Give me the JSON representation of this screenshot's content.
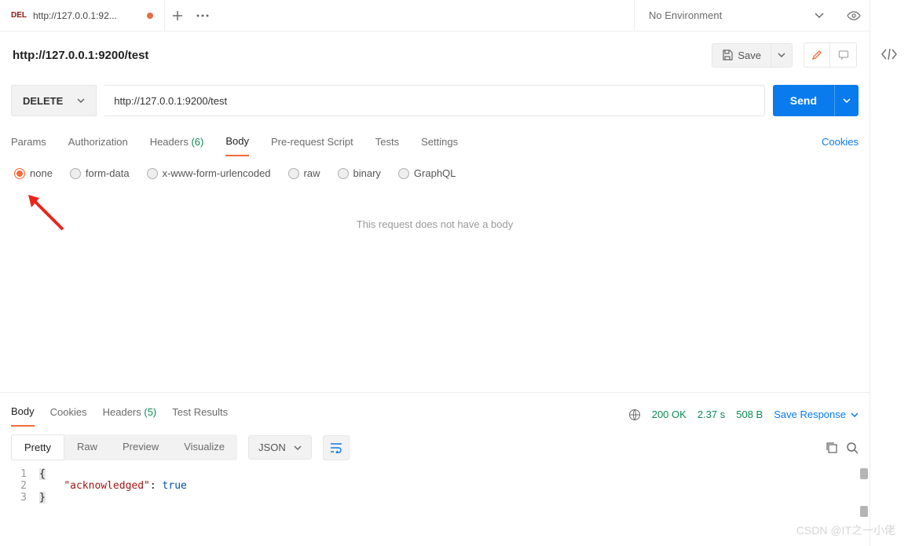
{
  "tab": {
    "method": "DEL",
    "title": "http://127.0.0.1:92..."
  },
  "env": {
    "name": "No Environment"
  },
  "request": {
    "title": "http://127.0.0.1:9200/test",
    "method": "DELETE",
    "url": "http://127.0.0.1:9200/test",
    "save_label": "Save",
    "send_label": "Send"
  },
  "req_tabs": {
    "params": "Params",
    "auth": "Authorization",
    "headers": "Headers",
    "headers_count": "(6)",
    "body": "Body",
    "prereq": "Pre-request Script",
    "tests": "Tests",
    "settings": "Settings",
    "cookies": "Cookies"
  },
  "body_types": {
    "none": "none",
    "formdata": "form-data",
    "xwww": "x-www-form-urlencoded",
    "raw": "raw",
    "binary": "binary",
    "graphql": "GraphQL"
  },
  "body_empty": "This request does not have a body",
  "resp_tabs": {
    "body": "Body",
    "cookies": "Cookies",
    "headers": "Headers",
    "headers_count": "(5)",
    "tests": "Test Results"
  },
  "resp_meta": {
    "status": "200 OK",
    "time": "2.37 s",
    "size": "508 B",
    "save": "Save Response"
  },
  "fmt": {
    "pretty": "Pretty",
    "raw": "Raw",
    "preview": "Preview",
    "viz": "Visualize",
    "json": "JSON"
  },
  "code": {
    "l1": "{",
    "l2k": "\"acknowledged\"",
    "l2c": ": ",
    "l2v": "true",
    "l3": "}"
  },
  "watermark": "CSDN @IT之一小佬"
}
